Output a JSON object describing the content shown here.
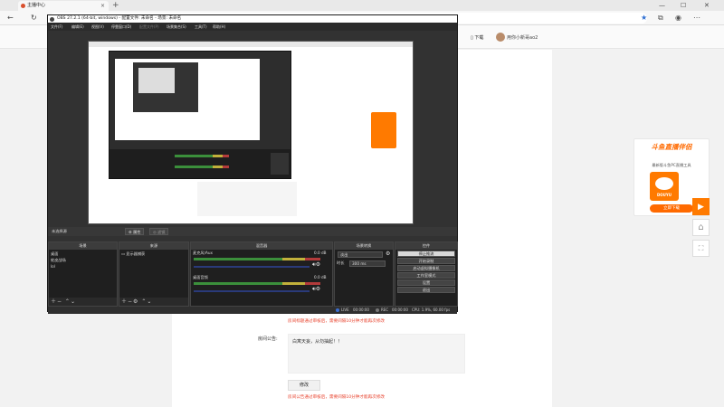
{
  "browser": {
    "tab_title": "主播中心",
    "new_tab": "+",
    "close_tab": "×",
    "win_min": "—",
    "win_max": "☐",
    "win_close": "✕",
    "back": "←",
    "reload": "↻",
    "download_label": "下载",
    "user_name": "用你小新哥ao2"
  },
  "obs": {
    "title": "OBS 27.2.1 (64-bit, windows) - 配置文件: 未命名 - 场景: 未命名",
    "menu": [
      "文件(F)",
      "编辑(E)",
      "视图(V)",
      "停靠窗口(D)",
      "配置文件(P)",
      "场景集合(S)",
      "工具(T)",
      "帮助(H)"
    ],
    "scene_header": "未选择源",
    "prop_btn": "属性",
    "filter_btn": "滤镜",
    "docks": {
      "scenes": {
        "title": "场景",
        "items": [
          "桌面",
          "蛇皮战场",
          "lol"
        ]
      },
      "sources": {
        "title": "来源",
        "items": [
          "显示器捕获"
        ]
      },
      "mixer": {
        "title": "混音器",
        "ch1_name": "麦克风/Aux",
        "ch1_db": "0.0 dB",
        "ch2_name": "桌面音频",
        "ch2_db": "0.0 dB"
      },
      "transitions": {
        "title": "场景转换",
        "type_value": "淡出",
        "duration_label": "时长",
        "duration_value": "300 ms"
      },
      "controls": {
        "title": "控件",
        "buttons": [
          "停止推流",
          "开始录制",
          "启动虚拟摄像机",
          "工作室模式",
          "设置",
          "退出"
        ]
      }
    },
    "status": {
      "live": "LIVE",
      "live_time": "00:00:00",
      "rec": "REC",
      "rec_time": "00:00:00",
      "cpu": "CPU: 1.9%, 60.00 fps"
    }
  },
  "douyu": {
    "title": "斗鱼直播伴侣",
    "subtitle": "最新版斗鱼PC直播工具",
    "download_button": "立即下载",
    "logo_text": "DOUYU"
  },
  "form": {
    "warning1": "房间标题通过审核后，需要间隔10分钟才能再次修改",
    "notice_label": "房间公告:",
    "notice_text": "白寓天妄，从勿抽起！！",
    "edit_button": "修改",
    "warning2": "房间公告通过审核后，需要间隔10分钟才能再次修改"
  }
}
